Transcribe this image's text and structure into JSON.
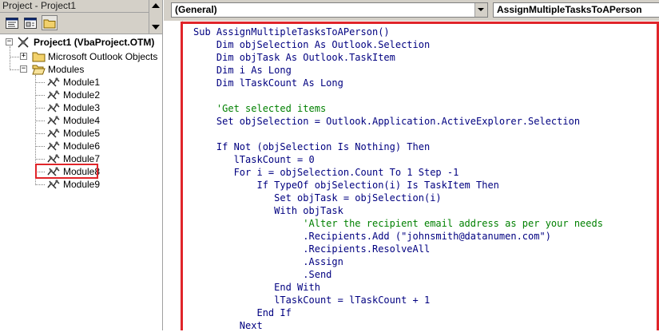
{
  "project_explorer": {
    "title": "Project - Project1",
    "close_label": "×",
    "toolbar": [
      {
        "icon": "view-code-icon"
      },
      {
        "icon": "view-object-icon"
      },
      {
        "icon": "toggle-folders-icon"
      }
    ],
    "tree": {
      "root": {
        "label": "Project1 (VbaProject.OTM)",
        "icon": "vba-project-icon",
        "expanded": true
      },
      "folders": [
        {
          "label": "Microsoft Outlook Objects",
          "icon": "folder-icon",
          "expanded": false
        },
        {
          "label": "Modules",
          "icon": "open-folder-icon",
          "expanded": true
        }
      ],
      "modules": [
        {
          "label": "Module1"
        },
        {
          "label": "Module2"
        },
        {
          "label": "Module3"
        },
        {
          "label": "Module4"
        },
        {
          "label": "Module5"
        },
        {
          "label": "Module6"
        },
        {
          "label": "Module7"
        },
        {
          "label": "Module8",
          "highlighted": true
        },
        {
          "label": "Module9"
        }
      ]
    }
  },
  "code_window": {
    "object_combo": "(General)",
    "procedure_combo": "AssignMultipleTasksToAPerson",
    "highlight_color": "#e0252a",
    "lines": [
      {
        "text": "Sub AssignMultipleTasksToAPerson()",
        "kind": "code"
      },
      {
        "text": "    Dim objSelection As Outlook.Selection",
        "kind": "code"
      },
      {
        "text": "    Dim objTask As Outlook.TaskItem",
        "kind": "code"
      },
      {
        "text": "    Dim i As Long",
        "kind": "code"
      },
      {
        "text": "    Dim lTaskCount As Long",
        "kind": "code"
      },
      {
        "text": "",
        "kind": "code"
      },
      {
        "text": "    'Get selected items",
        "kind": "comment"
      },
      {
        "text": "    Set objSelection = Outlook.Application.ActiveExplorer.Selection",
        "kind": "code"
      },
      {
        "text": "",
        "kind": "code"
      },
      {
        "text": "    If Not (objSelection Is Nothing) Then",
        "kind": "code"
      },
      {
        "text": "       lTaskCount = 0",
        "kind": "code"
      },
      {
        "text": "       For i = objSelection.Count To 1 Step -1",
        "kind": "code"
      },
      {
        "text": "           If TypeOf objSelection(i) Is TaskItem Then",
        "kind": "code"
      },
      {
        "text": "              Set objTask = objSelection(i)",
        "kind": "code"
      },
      {
        "text": "              With objTask",
        "kind": "code"
      },
      {
        "text": "                   'Alter the recipient email address as per your needs",
        "kind": "comment"
      },
      {
        "text": "                   .Recipients.Add (\"johnsmith@datanumen.com\")",
        "kind": "code"
      },
      {
        "text": "                   .Recipients.ResolveAll",
        "kind": "code"
      },
      {
        "text": "                   .Assign",
        "kind": "code"
      },
      {
        "text": "                   .Send",
        "kind": "code"
      },
      {
        "text": "              End With",
        "kind": "code"
      },
      {
        "text": "              lTaskCount = lTaskCount + 1",
        "kind": "code"
      },
      {
        "text": "           End If",
        "kind": "code"
      },
      {
        "text": "        Next",
        "kind": "code"
      }
    ]
  }
}
